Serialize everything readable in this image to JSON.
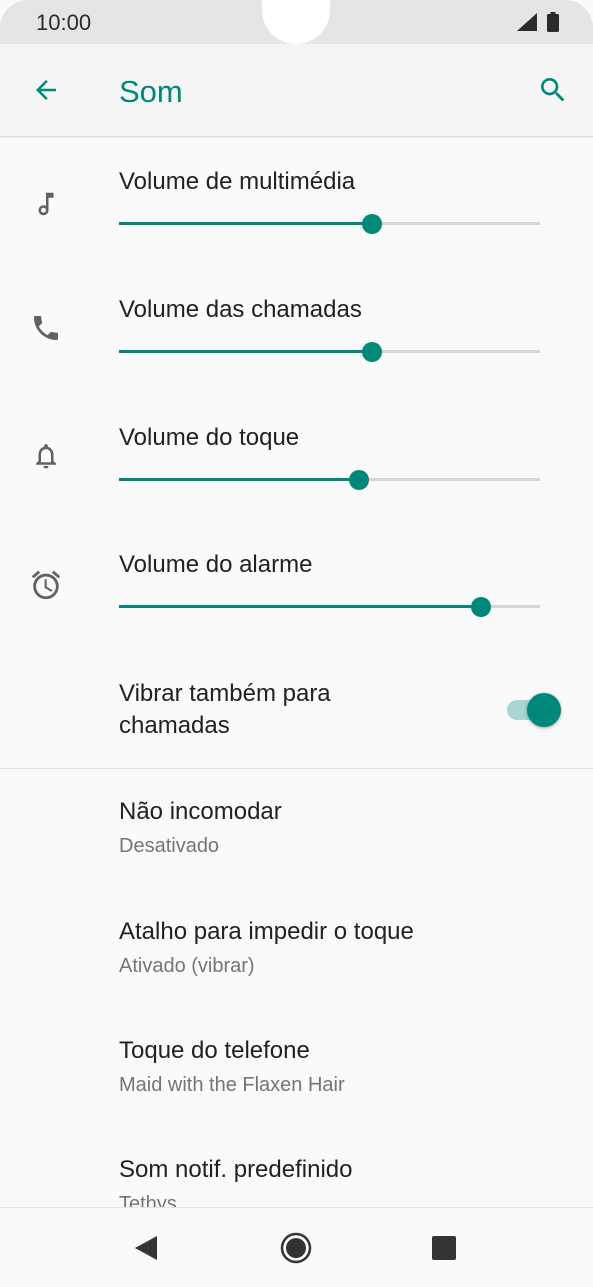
{
  "status_bar": {
    "time": "10:00"
  },
  "app_bar": {
    "title": "Som"
  },
  "sliders": [
    {
      "label": "Volume de multimédia",
      "icon": "music-note-icon",
      "value": 0.6
    },
    {
      "label": "Volume das chamadas",
      "icon": "phone-icon",
      "value": 0.6
    },
    {
      "label": "Volume do toque",
      "icon": "bell-icon",
      "value": 0.57
    },
    {
      "label": "Volume do alarme",
      "icon": "alarm-clock-icon",
      "value": 0.86
    }
  ],
  "vibrate": {
    "label": "Vibrar também para chamadas",
    "enabled": true
  },
  "settings": [
    {
      "title": "Não incomodar",
      "subtitle": "Desativado"
    },
    {
      "title": "Atalho para impedir o toque",
      "subtitle": "Ativado (vibrar)"
    },
    {
      "title": "Toque do telefone",
      "subtitle": "Maid with the Flaxen Hair"
    },
    {
      "title": "Som notif. predefinido",
      "subtitle": "Tethys"
    }
  ],
  "colors": {
    "accent": "#00897b",
    "track": "#d6d6d6",
    "toggle_track": "#a9d6d1",
    "icon": "#616161"
  }
}
